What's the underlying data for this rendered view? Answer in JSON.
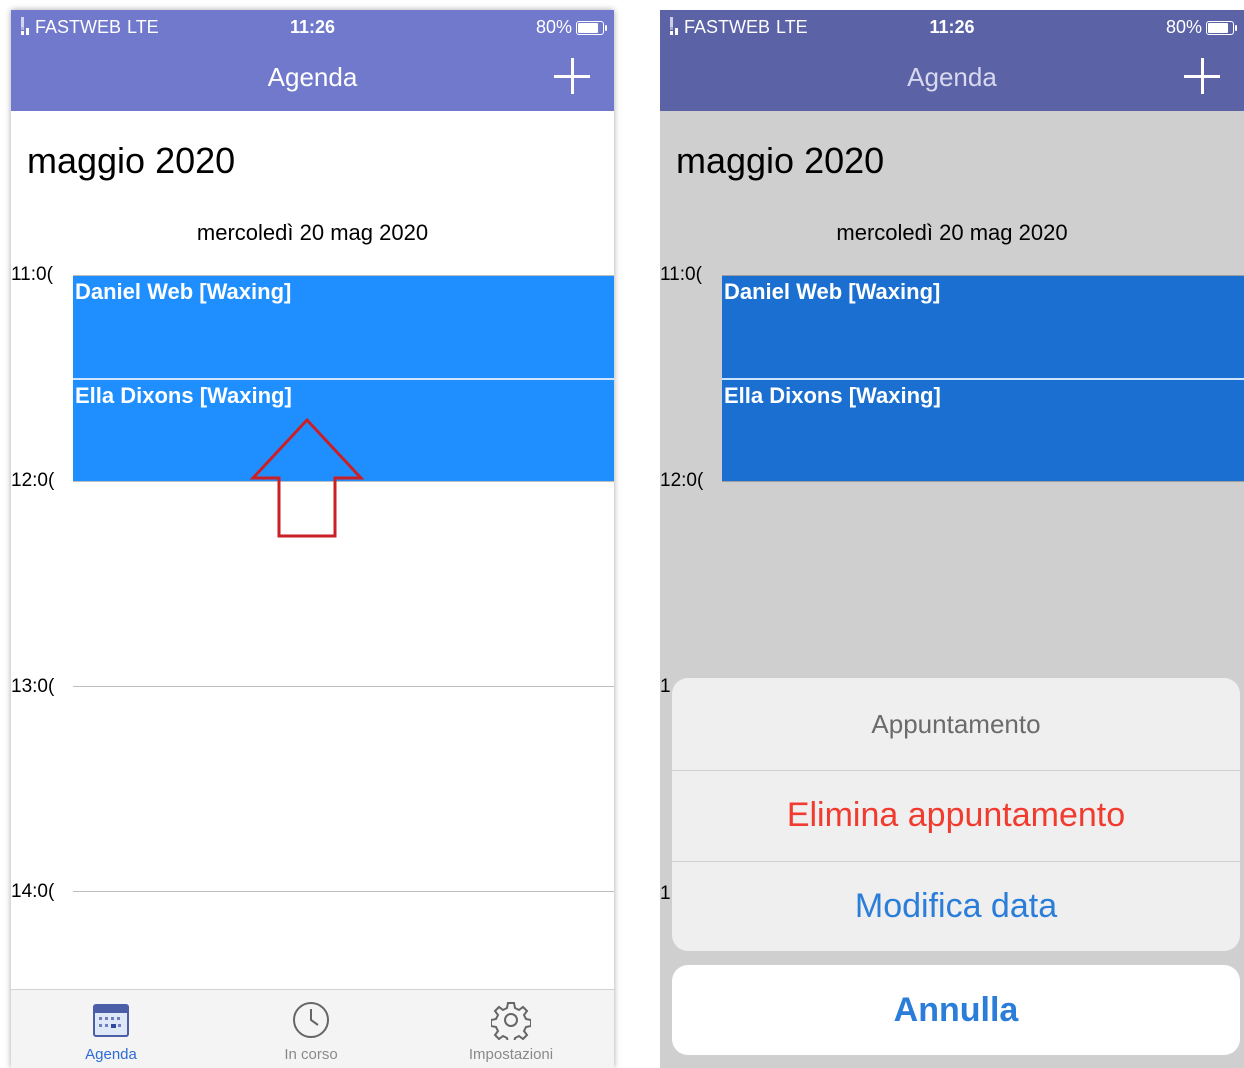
{
  "status": {
    "carrier": "FASTWEB",
    "network": "LTE",
    "time": "11:26",
    "battery": "80%"
  },
  "nav": {
    "title": "Agenda",
    "add_icon": "plus-icon"
  },
  "calendar": {
    "month": "maggio 2020",
    "day_header": "mercoledì  20 mag 2020",
    "hours": [
      "11:0(",
      "12:0(",
      "13:0(",
      "14:0("
    ],
    "events": [
      {
        "label": "Daniel Web [Waxing]"
      },
      {
        "label": "Ella Dixons [Waxing]"
      }
    ]
  },
  "annotation": {
    "shape": "up-arrow",
    "color": "#cc1f25"
  },
  "tabs": [
    {
      "label": "Agenda",
      "icon": "calendar-icon",
      "active": true
    },
    {
      "label": "In corso",
      "icon": "clock-icon",
      "active": false
    },
    {
      "label": "Impostazioni",
      "icon": "gear-icon",
      "active": false
    }
  ],
  "action_sheet": {
    "title": "Appuntamento",
    "delete_label": "Elimina appuntamento",
    "edit_label": "Modifica data",
    "cancel_label": "Annulla",
    "peek_hours": [
      "1",
      "1"
    ]
  },
  "colors": {
    "nav": "#7179cc",
    "event": "#1f8fff",
    "destructive": "#f23b2f",
    "action": "#2a7dd9"
  }
}
